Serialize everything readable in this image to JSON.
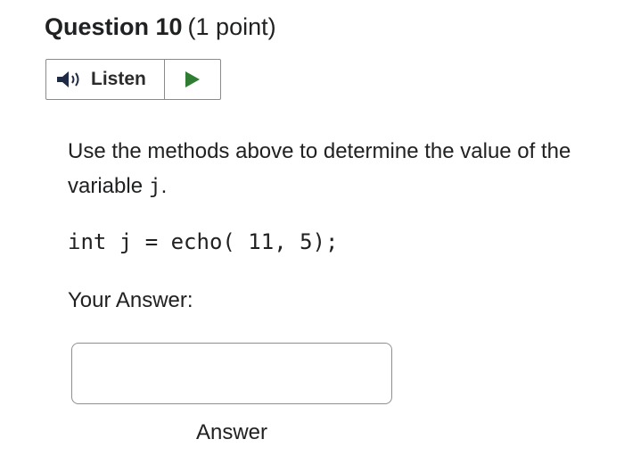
{
  "question": {
    "title": "Question 10",
    "points": "(1 point)"
  },
  "listen": {
    "label": "Listen",
    "speaker_icon": "speaker-icon",
    "play_icon": "play-icon",
    "play_color": "#2e7d32"
  },
  "prompt": {
    "text_before": "Use the methods above to determine the value of the variable ",
    "variable": "j",
    "text_after": "."
  },
  "code": "int j = echo( 11, 5);",
  "answer": {
    "label": "Your Answer:",
    "value": "",
    "caption": "Answer"
  }
}
